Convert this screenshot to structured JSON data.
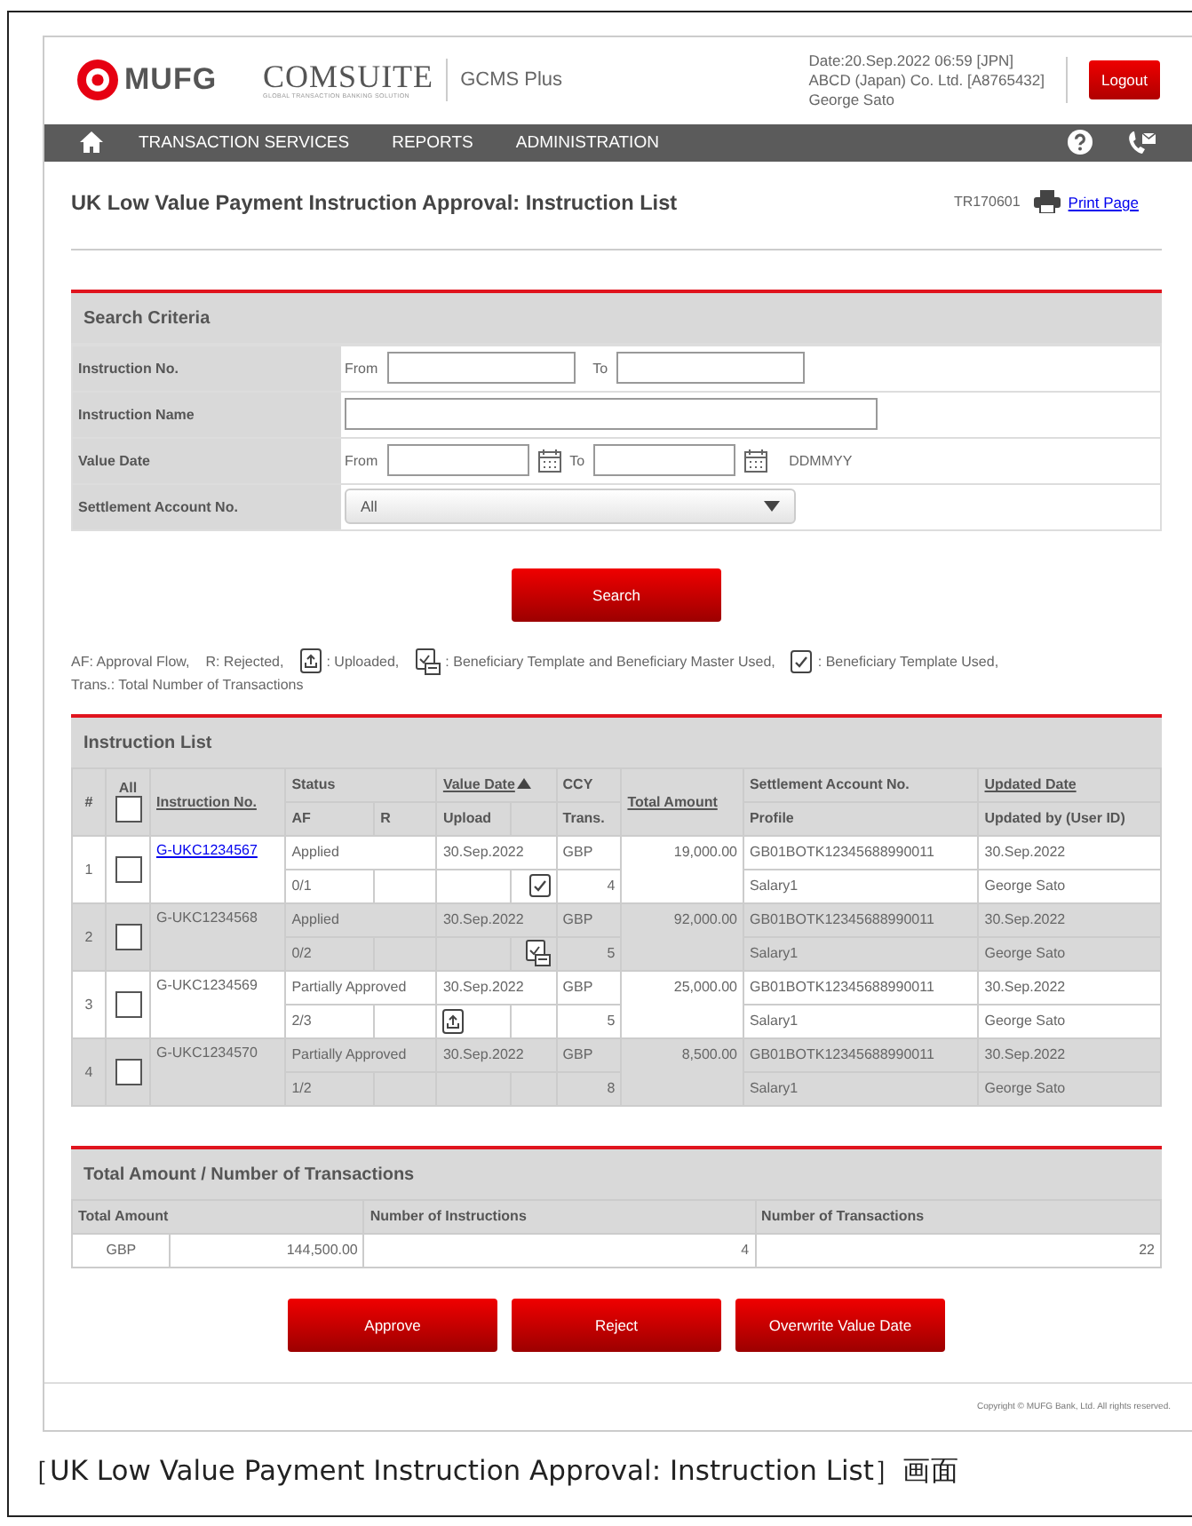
{
  "header": {
    "logo_text": "MUFG",
    "product_name": "COMSUITE",
    "product_tagline": "GLOBAL TRANSACTION BANKING SOLUTION",
    "system_name": "GCMS Plus",
    "session_lines": [
      "Date:20.Sep.2022 06:59 [JPN]",
      "ABCD (Japan) Co. Ltd. [A8765432]",
      "George Sato"
    ],
    "logout_label": "Logout"
  },
  "nav": {
    "items": [
      "TRANSACTION SERVICES",
      "REPORTS",
      "ADMINISTRATION"
    ]
  },
  "page": {
    "title": "UK Low Value Payment Instruction Approval: Instruction List",
    "screen_id": "TR170601",
    "print_label": "Print Page"
  },
  "search": {
    "title": "Search Criteria",
    "button": "Search",
    "fields": [
      {
        "kind": "range",
        "label": "Instruction No.",
        "from_label": "From",
        "to_label": "To"
      },
      {
        "kind": "text",
        "label": "Instruction Name"
      },
      {
        "kind": "date_range",
        "label": "Value Date",
        "from_label": "From",
        "to_label": "To",
        "format_hint": "DDMMYY"
      },
      {
        "kind": "select",
        "label": "Settlement Account No.",
        "value": "All"
      }
    ]
  },
  "legend": [
    {
      "kind": "text",
      "text": "AF: Approval Flow,"
    },
    {
      "kind": "text",
      "text": "R: Rejected,"
    },
    {
      "kind": "uploaded",
      "text": ": Uploaded,"
    },
    {
      "kind": "template_master",
      "text": ": Beneficiary Template and Beneficiary Master Used,"
    },
    {
      "kind": "template",
      "text": ": Beneficiary Template Used,"
    },
    {
      "kind": "text",
      "text": "Trans.: Total Number of Transactions"
    }
  ],
  "instruction_list": {
    "title": "Instruction List",
    "all_selected": false,
    "columns": {
      "number": {
        "text": "#",
        "sortable": false
      },
      "all": {
        "text": "All",
        "sortable": false
      },
      "instruction_no": {
        "text": "Instruction No.",
        "sortable": true
      },
      "status": {
        "text": "Status",
        "sortable": false
      },
      "af": {
        "text": "AF",
        "sortable": false
      },
      "r": {
        "text": "R",
        "sortable": false
      },
      "value_date": {
        "text": "Value Date",
        "sortable": true,
        "sorted": true
      },
      "upload": {
        "text": "Upload",
        "sortable": false
      },
      "ccy": {
        "text": "CCY",
        "sortable": false
      },
      "trans": {
        "text": "Trans.",
        "sortable": false
      },
      "total_amount": {
        "text": "Total Amount",
        "sortable": true
      },
      "settlement_account": {
        "text": "Settlement Account No.",
        "sortable": false
      },
      "profile": {
        "text": "Profile",
        "sortable": false
      },
      "updated_date": {
        "text": "Updated Date",
        "sortable": true
      },
      "updated_by": {
        "text": "Updated by (User ID)",
        "sortable": false
      }
    },
    "rows": [
      {
        "number": "1",
        "selected": false,
        "instruction_no": "G-UKC1234567",
        "linked": true,
        "status": "Applied",
        "af": "0/1",
        "value_date": "30.Sep.2022",
        "kind": "template",
        "ccy": "GBP",
        "trans": "4",
        "total_amount": "19,000.00",
        "settlement_account": "GB01BOTK12345688990011",
        "profile": "Salary1",
        "updated_date": "30.Sep.2022",
        "updated_by": "George Sato"
      },
      {
        "number": "2",
        "selected": false,
        "instruction_no": "G-UKC1234568",
        "linked": false,
        "status": "Applied",
        "af": "0/2",
        "value_date": "30.Sep.2022",
        "kind": "template_master",
        "ccy": "GBP",
        "trans": "5",
        "total_amount": "92,000.00",
        "settlement_account": "GB01BOTK12345688990011",
        "profile": "Salary1",
        "updated_date": "30.Sep.2022",
        "updated_by": "George Sato"
      },
      {
        "number": "3",
        "selected": false,
        "instruction_no": "G-UKC1234569",
        "linked": false,
        "status": "Partially Approved",
        "af": "2/3",
        "value_date": "30.Sep.2022",
        "kind": "uploaded",
        "ccy": "GBP",
        "trans": "5",
        "total_amount": "25,000.00",
        "settlement_account": "GB01BOTK12345688990011",
        "profile": "Salary1",
        "updated_date": "30.Sep.2022",
        "updated_by": "George Sato"
      },
      {
        "number": "4",
        "selected": false,
        "instruction_no": "G-UKC1234570",
        "linked": false,
        "status": "Partially Approved",
        "af": "1/2",
        "value_date": "30.Sep.2022",
        "kind": "plain",
        "ccy": "GBP",
        "trans": "8",
        "total_amount": "8,500.00",
        "settlement_account": "GB01BOTK12345688990011",
        "profile": "Salary1",
        "updated_date": "30.Sep.2022",
        "updated_by": "George Sato"
      }
    ]
  },
  "totals": {
    "title": "Total Amount / Number of Transactions",
    "columns": [
      "Total Amount",
      "Number of Instructions",
      "Number of Transactions"
    ],
    "currency": "GBP",
    "total_amount": "144,500.00",
    "number_of_instructions": "4",
    "number_of_transactions": "22"
  },
  "actions": [
    "Approve",
    "Reject",
    "Overwrite Value Date"
  ],
  "copyright": "Copyright © MUFG Bank, Ltd. All rights reserved.",
  "caption": "［UK Low Value Payment Instruction Approval: Instruction List］画面"
}
